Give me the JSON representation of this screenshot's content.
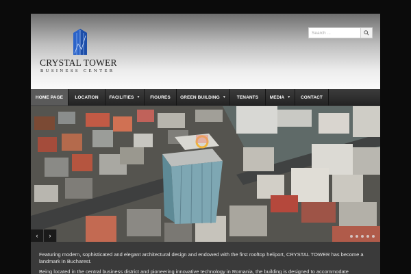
{
  "header": {
    "logo_title": "CRYSTAL TOWER",
    "logo_subtitle": "BUSINESS CENTER",
    "search_placeholder": "Search ...",
    "search_icon": "search-icon"
  },
  "nav": {
    "items": [
      {
        "label": "HOME PAGE",
        "active": true,
        "dropdown": false
      },
      {
        "label": "LOCATION",
        "active": false,
        "dropdown": false
      },
      {
        "label": "FACILITIES",
        "active": false,
        "dropdown": true
      },
      {
        "label": "FIGURES",
        "active": false,
        "dropdown": false
      },
      {
        "label": "GREEN BUILDING",
        "active": false,
        "dropdown": true
      },
      {
        "label": "TENANTS",
        "active": false,
        "dropdown": false
      },
      {
        "label": "MEDIA",
        "active": false,
        "dropdown": true
      },
      {
        "label": "CONTACT",
        "active": false,
        "dropdown": false
      }
    ]
  },
  "slider": {
    "prev_icon": "chevron-left-icon",
    "next_icon": "chevron-right-icon",
    "prev_glyph": "‹",
    "next_glyph": "›",
    "slide_count": 5,
    "active_slide": 1
  },
  "content": {
    "paragraph_1": "Featuring  modern, sophisticated and elegant architectural design and endowed with  the first rooftop heliport, CRYSTAL TOWER has become a landmark in Bucharest.",
    "paragraph_2": "Being located in the central business district and pioneering innovative technology  in Romania, the building is designed to accommodate"
  },
  "colors": {
    "logo_blue": "#2b63c9",
    "nav_bg": "#2b2b2b",
    "nav_active": "#5a5a5a",
    "content_bg": "#3a3a3a"
  }
}
